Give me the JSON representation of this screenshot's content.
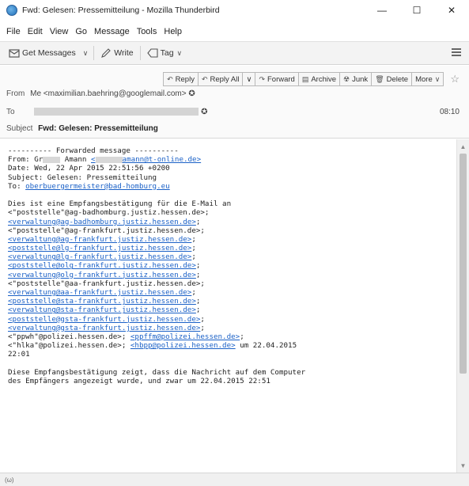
{
  "window": {
    "title": "Fwd: Gelesen: Pressemitteilung - Mozilla Thunderbird",
    "controls": {
      "minimize": "—",
      "maximize": "☐",
      "close": "✕"
    }
  },
  "menubar": [
    "File",
    "Edit",
    "View",
    "Go",
    "Message",
    "Tools",
    "Help"
  ],
  "toolbar": {
    "get_messages": "Get Messages",
    "write": "Write",
    "tag": "Tag"
  },
  "header_actions": {
    "reply": "Reply",
    "reply_all": "Reply All",
    "forward": "Forward",
    "archive": "Archive",
    "junk": "Junk",
    "delete": "Delete",
    "more": "More"
  },
  "header": {
    "from_label": "From",
    "from_value": "Me <maximilian.baehring@googlemail.com>",
    "to_label": "To",
    "time": "08:10",
    "subject_label": "Subject",
    "subject_value": "Fwd: Gelesen: Pressemitteilung"
  },
  "body": {
    "fwd_header": "---------- Forwarded message ----------",
    "from_prefix": "From: Gr",
    "from_mid": " Amann ",
    "from_link_a": "<",
    "from_link_b": "amann@t-online.de>",
    "date_line": "Date: Wed, 22 Apr 2015 22:51:56 +0200",
    "subject_line": "Subject: Gelesen: Pressemitteilung",
    "to_prefix": "To: ",
    "to_link": "oberbuergermeister@bad-homburg.eu",
    "intro": "Dies ist eine Empfangsbestätigung für die E-Mail an",
    "l1": "<\"poststelle\"@ag-badhomburg.justiz.hessen.de>;",
    "l2": "<verwaltung@ag-badhomburg.justiz.hessen.de>",
    "l2_suffix": ";",
    "l3": "<\"poststelle\"@ag-frankfurt.justiz.hessen.de>;",
    "l4": "<verwaltung@ag-frankfurt.justiz.hessen.de>",
    "l4_suffix": ";",
    "l5": "<poststelle@lg-frankfurt.justiz.hessen.de>",
    "l5_suffix": ";",
    "l6": "<verwaltung@lg-frankfurt.justiz.hessen.de>",
    "l6_suffix": ";",
    "l7": "<poststelle@olg-frankfurt.justiz.hessen.de>",
    "l7_suffix": ";",
    "l8": "<verwaltung@olg-frankfurt.justiz.hessen.de>",
    "l8_suffix": ";",
    "l9": "<\"poststelle\"@aa-frankfurt.justiz.hessen.de>;",
    "l10": "<verwaltung@aa-frankfurt.justiz.hessen.de>",
    "l10_suffix": ";",
    "l11": "<poststelle@sta-frankfurt.justiz.hessen.de>",
    "l11_suffix": ";",
    "l12": "<verwaltung@sta-frankfurt.justiz.hessen.de>",
    "l12_suffix": ";",
    "l13": "<poststelle@gsta-frankfurt.justiz.hessen.de>",
    "l13_suffix": ";",
    "l14": "<verwaltung@gsta-frankfurt.justiz.hessen.de>",
    "l14_suffix": ";",
    "l15_prefix": "<\"ppwh\"@polizei.hessen.de>; ",
    "l15_link": "<ppffm@polizei.hessen.de>",
    "l15_suffix": ";",
    "l16_prefix": "<\"hlka\"@polizei.hessen.de>; ",
    "l16_link": "<hbpp@polizei.hessen.de>",
    "l16_suffix": " um 22.04.2015",
    "l17": "22:01",
    "outro1": "Diese Empfangsbestätigung zeigt, dass die Nachricht auf dem Computer",
    "outro2": "des Empfängers angezeigt wurde, und zwar um 22.04.2015 22:51"
  },
  "statusbar": {
    "text": "(ω)"
  }
}
